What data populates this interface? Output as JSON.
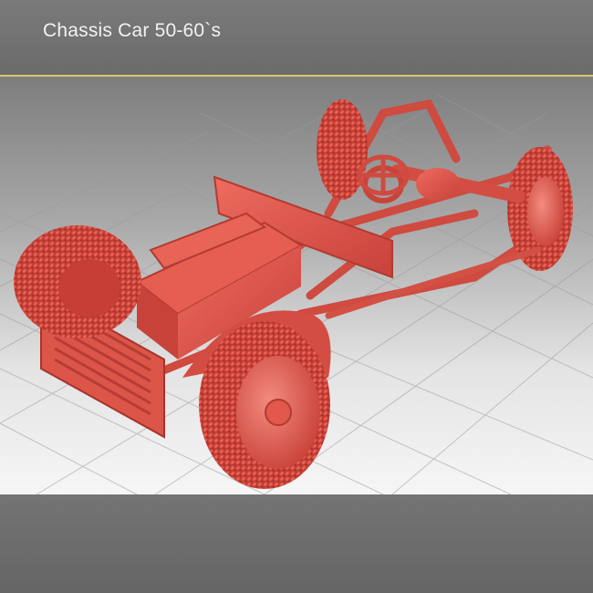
{
  "header": {
    "title": "Chassis Car 50-60`s"
  },
  "colors": {
    "accent": "#d8c56a",
    "model": "#e2584c",
    "background_top": "#7c7c7c",
    "floor": "#f2f2f2"
  },
  "icons": [
    "car-chassis-render"
  ]
}
